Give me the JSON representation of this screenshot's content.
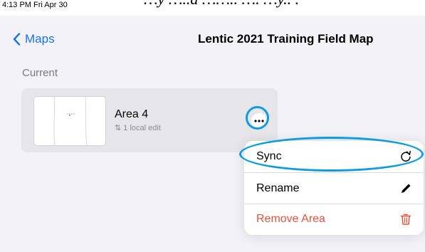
{
  "status_bar": {
    "time": "4:13 PM  Fri Apr 30"
  },
  "caption_clip": "…y …..d …….. …. …y.. .",
  "nav": {
    "back_label": "Maps",
    "title": "Lentic 2021 Training Field Map"
  },
  "section": {
    "label": "Current"
  },
  "area": {
    "name": "Area 4",
    "edits_text": "⇅ 1 local edit"
  },
  "menu": {
    "items": [
      {
        "label": "Sync",
        "icon": "sync-icon",
        "color": "#000000"
      },
      {
        "label": "Rename",
        "icon": "pencil-icon",
        "color": "#000000"
      },
      {
        "label": "Remove Area",
        "icon": "trash-icon",
        "color": "#e5533d"
      }
    ]
  },
  "colors": {
    "accent": "#1a73e8",
    "highlight": "#0e9be0",
    "destructive": "#e5533d",
    "background": "#f2f2f7"
  }
}
